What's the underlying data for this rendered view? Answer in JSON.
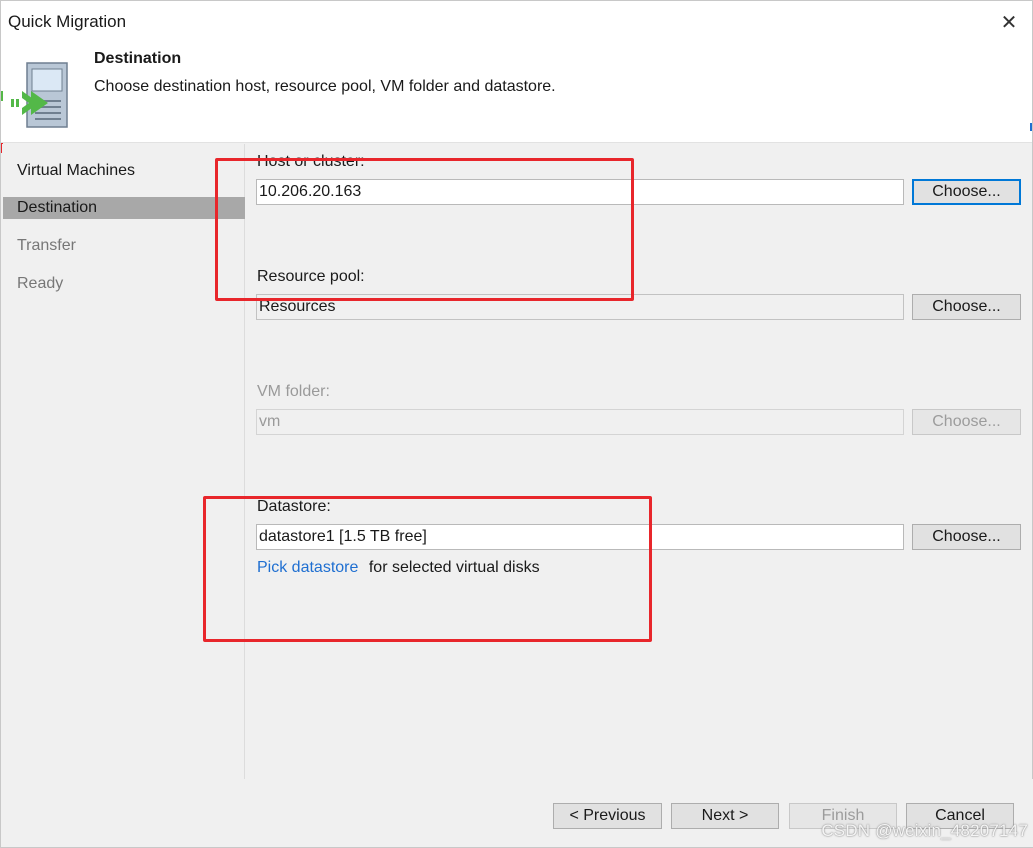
{
  "window": {
    "title": "Quick Migration"
  },
  "header": {
    "step_title": "Destination",
    "description": "Choose destination host, resource pool, VM folder and datastore."
  },
  "steps": [
    {
      "label": "Virtual Machines",
      "state": "done"
    },
    {
      "label": "Destination",
      "state": "active"
    },
    {
      "label": "Transfer",
      "state": "pending"
    },
    {
      "label": "Ready",
      "state": "pending"
    }
  ],
  "form": {
    "host": {
      "label": "Host or cluster:",
      "value": "10.206.20.163",
      "button": "Choose..."
    },
    "resource_pool": {
      "label": "Resource pool:",
      "value": "Resources",
      "button": "Choose..."
    },
    "vm_folder": {
      "label": "VM folder:",
      "value": "vm",
      "button": "Choose...",
      "enabled": false
    },
    "datastore": {
      "label": "Datastore:",
      "value": "datastore1 [1.5 TB free]",
      "button": "Choose...",
      "link_text": "Pick datastore",
      "link_suffix": "for selected virtual disks"
    }
  },
  "footer": {
    "previous": "< Previous",
    "next": "Next >",
    "finish": "Finish",
    "cancel": "Cancel"
  },
  "watermark": "CSDN @weixin_48207147",
  "colors": {
    "accent": "#0078d7",
    "link": "#1f6fd1",
    "annotation_red": "#e8262b",
    "active_step_bg": "#a8a8a8"
  },
  "icons": {
    "close": "close-icon",
    "wizard": "vm-migration-icon"
  }
}
